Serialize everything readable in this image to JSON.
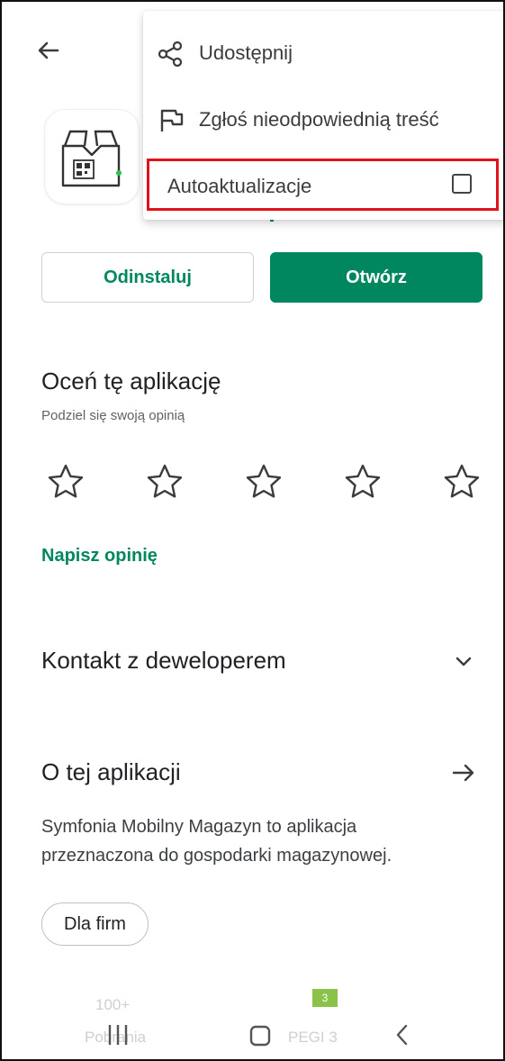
{
  "menu": {
    "share_label": "Udostępnij",
    "report_label": "Zgłoś nieodpowiednią treść",
    "autoupdate_label": "Autoaktualizacje",
    "autoupdate_checked": false
  },
  "buttons": {
    "uninstall": "Odinstaluj",
    "open": "Otwórz"
  },
  "rating": {
    "title": "Oceń tę aplikację",
    "subtitle": "Podziel się swoją opinią",
    "stars": 5,
    "write_review": "Napisz opinię"
  },
  "sections": {
    "contact": "Kontakt z deweloperem",
    "about": "O tej aplikacji",
    "description": "Symfonia Mobilny Magazyn to aplikacja przeznaczona do gospodarki magazynowej.",
    "chip": "Dla firm"
  },
  "stats": {
    "downloads": "100+",
    "downloads_label": "Pobrania",
    "pegi": "PEGI 3"
  },
  "colors": {
    "accent": "#01875f",
    "highlight": "#e0121a"
  },
  "icons": {
    "back": "arrow-left-icon",
    "share": "share-icon",
    "report": "flag-icon",
    "contact_expand": "chevron-down-icon",
    "about_more": "arrow-right-icon",
    "rating": "star-outline-icon"
  }
}
